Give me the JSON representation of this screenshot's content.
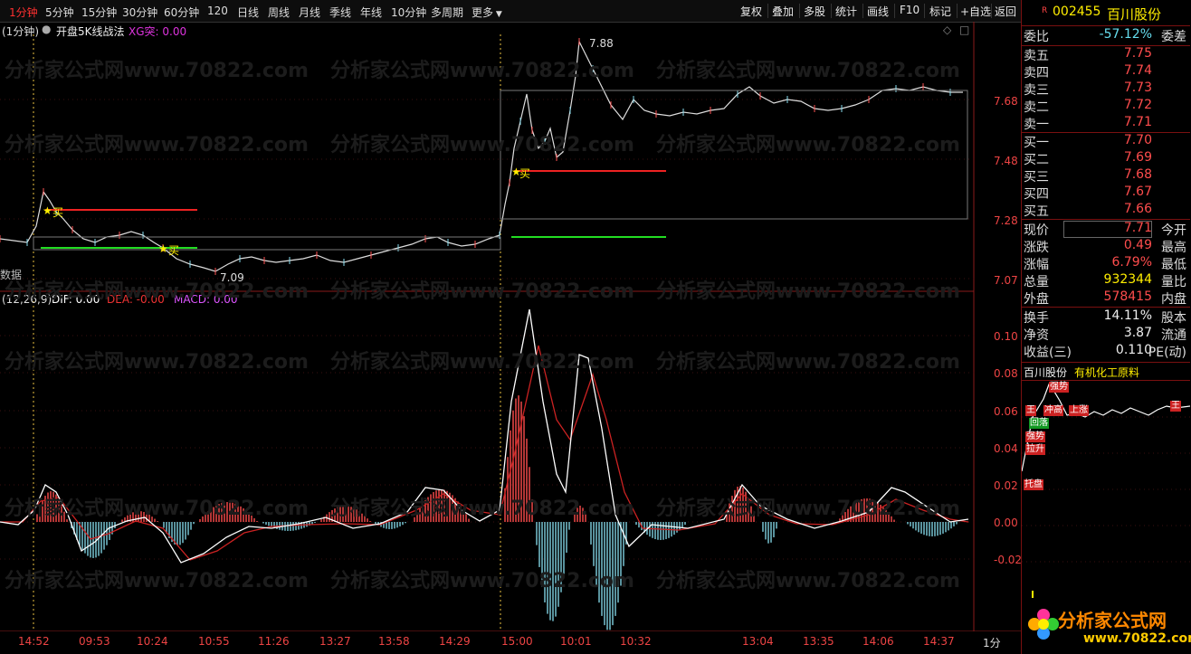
{
  "toolbar": {
    "periods": [
      "1分钟",
      "5分钟",
      "15分钟",
      "30分钟",
      "60分钟",
      "120",
      "日线",
      "周线",
      "月线",
      "季线",
      "年线",
      "10分钟",
      "多周期",
      "更多"
    ],
    "actions": [
      "复权",
      "叠加",
      "多股",
      "统计",
      "画线",
      "F10",
      "标记",
      "+自选",
      "返回"
    ]
  },
  "main_chart": {
    "period_label": "(1分钟)",
    "indicator_name": "开盘5K线战法",
    "xg_label": "XG突: 0.00",
    "price_ticks": [
      "7.68",
      "7.48",
      "7.28",
      "7.07"
    ],
    "high_label": "7.88",
    "low_label": "7.09",
    "buy_mark": "买",
    "data_label": "数据"
  },
  "macd_chart": {
    "params": "(12,26,9)",
    "dif": "DIF: 0.00",
    "dea": "DEA: -0.00",
    "macd": "MACD: 0.00",
    "ticks": [
      "0.10",
      "0.08",
      "0.06",
      "0.04",
      "0.02",
      "0.00",
      "-0.02"
    ]
  },
  "time_axis": [
    "14:52",
    "09:53",
    "10:24",
    "10:55",
    "11:26",
    "13:27",
    "13:58",
    "14:29",
    "15:00",
    "10:01",
    "10:32",
    "13:04",
    "13:35",
    "14:06",
    "14:37"
  ],
  "axis_unit": "1分",
  "watermark": "分析家公式网www.70822.com",
  "stock": {
    "mark": "R",
    "code": "002455",
    "name": "百川股份",
    "industry": "有机化工原料",
    "weibi_label": "委比",
    "weibi_value": "-57.12%",
    "weicha_label": "委差",
    "asks": [
      {
        "label": "卖五",
        "price": "7.75"
      },
      {
        "label": "卖四",
        "price": "7.74"
      },
      {
        "label": "卖三",
        "price": "7.73"
      },
      {
        "label": "卖二",
        "price": "7.72"
      },
      {
        "label": "卖一",
        "price": "7.71"
      }
    ],
    "bids": [
      {
        "label": "买一",
        "price": "7.70"
      },
      {
        "label": "买二",
        "price": "7.69"
      },
      {
        "label": "买三",
        "price": "7.68"
      },
      {
        "label": "买四",
        "price": "7.67"
      },
      {
        "label": "买五",
        "price": "7.66"
      }
    ],
    "quote": [
      {
        "l": "现价",
        "v": "7.71",
        "r": "今开"
      },
      {
        "l": "涨跌",
        "v": "0.49",
        "r": "最高"
      },
      {
        "l": "涨幅",
        "v": "6.79%",
        "r": "最低"
      },
      {
        "l": "总量",
        "v": "932344",
        "r": "量比"
      },
      {
        "l": "外盘",
        "v": "578415",
        "r": "内盘"
      },
      {
        "l": "换手",
        "v": "14.11%",
        "r": "股本"
      },
      {
        "l": "净资",
        "v": "3.87",
        "r": "流通"
      },
      {
        "l": "收益(三)",
        "v": "0.110",
        "r": "PE(动)"
      }
    ]
  },
  "mini_tags": [
    "强势",
    "王",
    "冲高",
    "上涨",
    "回落",
    "强势",
    "拉升",
    "托盘",
    "王"
  ],
  "logo": {
    "name": "分析家公式网",
    "url": "www.70822.com"
  },
  "colors": {
    "up": "#ff4d4d",
    "down": "#7fd0e0",
    "dif": "#ffffff",
    "dea": "#cc2222",
    "buyline": "#ee2222",
    "sellline": "#22dd22",
    "vline": "#e8c040"
  }
}
